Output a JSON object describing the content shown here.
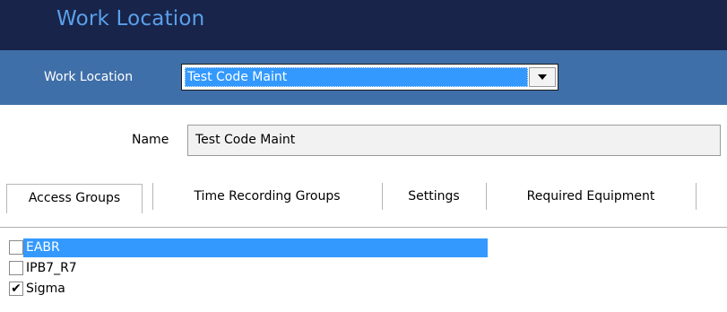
{
  "window": {
    "title": "Work Location"
  },
  "selector": {
    "label": "Work Location",
    "value": "Test Code Maint",
    "dropdown_icon": "chevron-down-icon"
  },
  "form": {
    "name_label": "Name",
    "name_value": "Test Code Maint"
  },
  "tabs": [
    {
      "label": "Access Groups",
      "active": true
    },
    {
      "label": "Time Recording Groups",
      "active": false
    },
    {
      "label": "Settings",
      "active": false
    },
    {
      "label": "Required Equipment",
      "active": false
    }
  ],
  "access_groups": [
    {
      "label": "EABR",
      "checked": false,
      "selected": true
    },
    {
      "label": "IPB7_R7",
      "checked": false,
      "selected": false
    },
    {
      "label": "Sigma",
      "checked": true,
      "selected": false
    }
  ],
  "colors": {
    "title_bar": "#18244a",
    "title_text": "#5aa0ea",
    "selector_band": "#3f6fa8",
    "selection": "#3399ff"
  }
}
